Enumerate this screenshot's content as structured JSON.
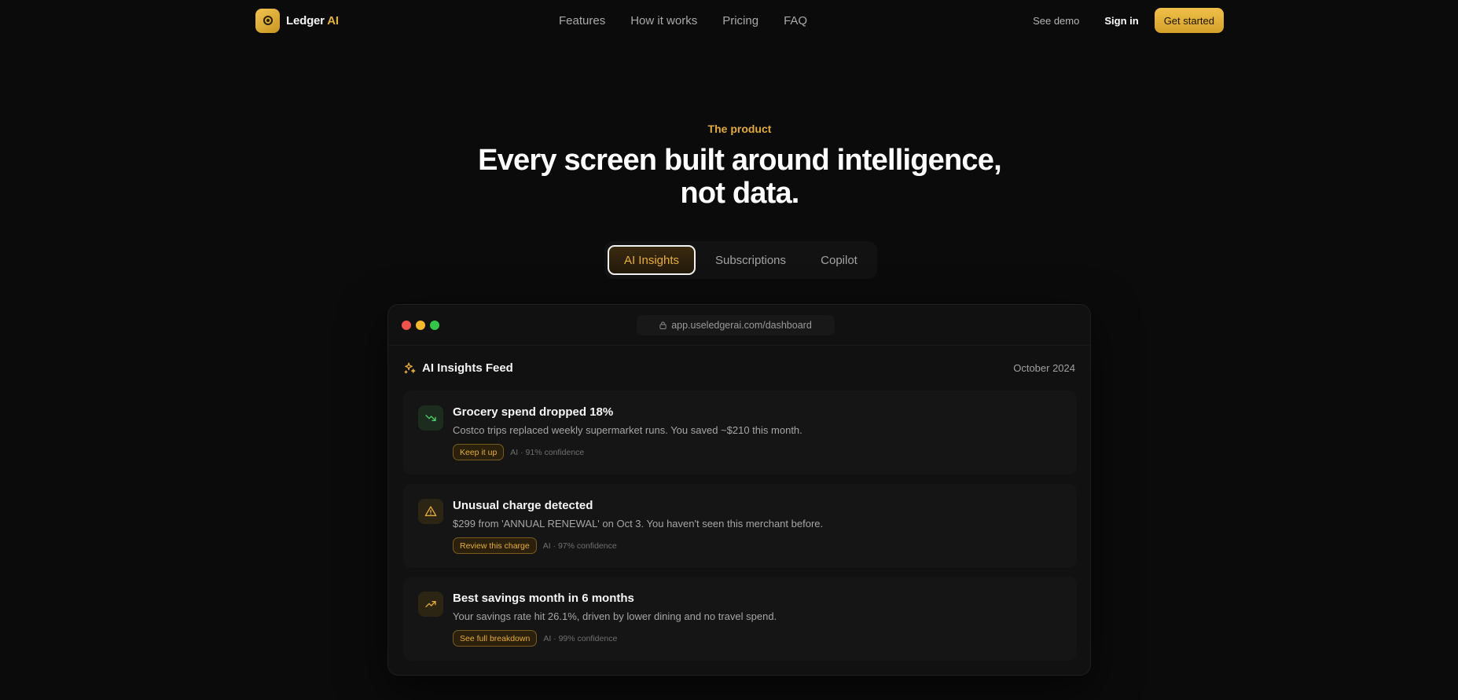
{
  "nav": {
    "brand": "Ledger",
    "brand_suffix": "AI",
    "links": [
      "Features",
      "How it works",
      "Pricing",
      "FAQ"
    ],
    "see_demo": "See demo",
    "sign_in": "Sign in",
    "get_started": "Get started"
  },
  "hero": {
    "eyebrow": "The product",
    "title_line1": "Every screen built around intelligence,",
    "title_line2": "not data."
  },
  "tabs": [
    {
      "label": "AI Insights",
      "active": true
    },
    {
      "label": "Subscriptions",
      "active": false
    },
    {
      "label": "Copilot",
      "active": false
    }
  ],
  "window": {
    "url": "app.useledgerai.com/dashboard",
    "feed_title": "AI Insights Feed",
    "feed_date": "October 2024",
    "cards": [
      {
        "icon": "trending-down-icon",
        "title": "Grocery spend dropped 18%",
        "description": "Costco trips replaced weekly supermarket runs. You saved ~$210 this month.",
        "action": "Keep it up",
        "confidence": "AI · 91% confidence"
      },
      {
        "icon": "warning-icon",
        "title": "Unusual charge detected",
        "description": "$299 from 'ANNUAL RENEWAL' on Oct 3. You haven't seen this merchant before.",
        "action": "Review this charge",
        "confidence": "AI · 97% confidence"
      },
      {
        "icon": "trending-up-icon",
        "title": "Best savings month in 6 months",
        "description": "Your savings rate hit 26.1%, driven by lower dining and no travel spend.",
        "action": "See full breakdown",
        "confidence": "AI · 99% confidence"
      }
    ]
  },
  "colors": {
    "background": "#0b0b0b",
    "accent": "#e5b23e",
    "card": "#151515"
  }
}
